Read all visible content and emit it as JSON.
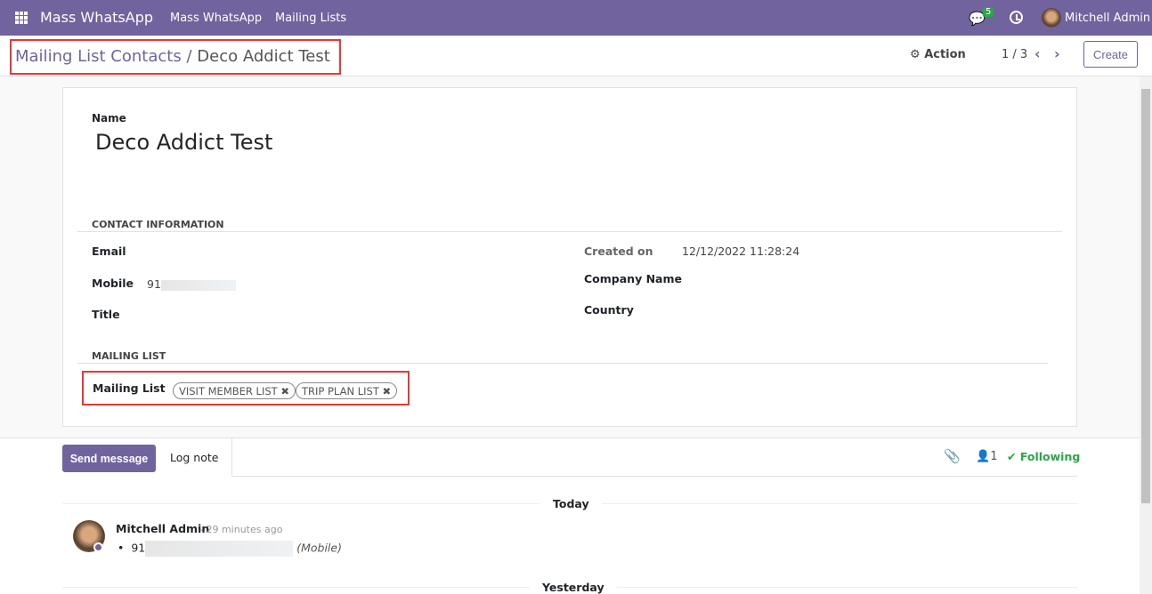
{
  "navbar": {
    "app_name": "Mass WhatsApp",
    "menu": [
      "Mass WhatsApp",
      "Mailing Lists"
    ],
    "message_count": "5",
    "user_name": "Mitchell Admin"
  },
  "breadcrumb": {
    "parent": "Mailing List Contacts",
    "separator": "/",
    "current": "Deco Addict Test"
  },
  "controls": {
    "action_label": "Action",
    "pager": "1 / 3",
    "create_label": "Create"
  },
  "form": {
    "name_label": "Name",
    "name_value": "Deco Addict Test",
    "contact_section": "Contact Information",
    "email_label": "Email",
    "mobile_label": "Mobile",
    "mobile_value": "91",
    "title_label": "Title",
    "created_on_label": "Created on",
    "created_on_value": "12/12/2022 11:28:24",
    "company_label": "Company Name",
    "country_label": "Country",
    "mailing_section": "Mailing List",
    "mailing_label": "Mailing List",
    "tags": [
      "VISIT MEMBER LIST",
      "TRIP PLAN LIST"
    ]
  },
  "chatter": {
    "send_label": "Send message",
    "log_label": "Log note",
    "followers_count": "1",
    "following_label": "Following",
    "today_label": "Today",
    "yesterday_label": "Yesterday",
    "message": {
      "author": "Mitchell Admin",
      "time": "- 29 minutes ago",
      "value": "91",
      "suffix": "(Mobile)"
    }
  },
  "colors": {
    "brand": "#71639e",
    "success": "#28a745",
    "highlight": "#e53935"
  }
}
